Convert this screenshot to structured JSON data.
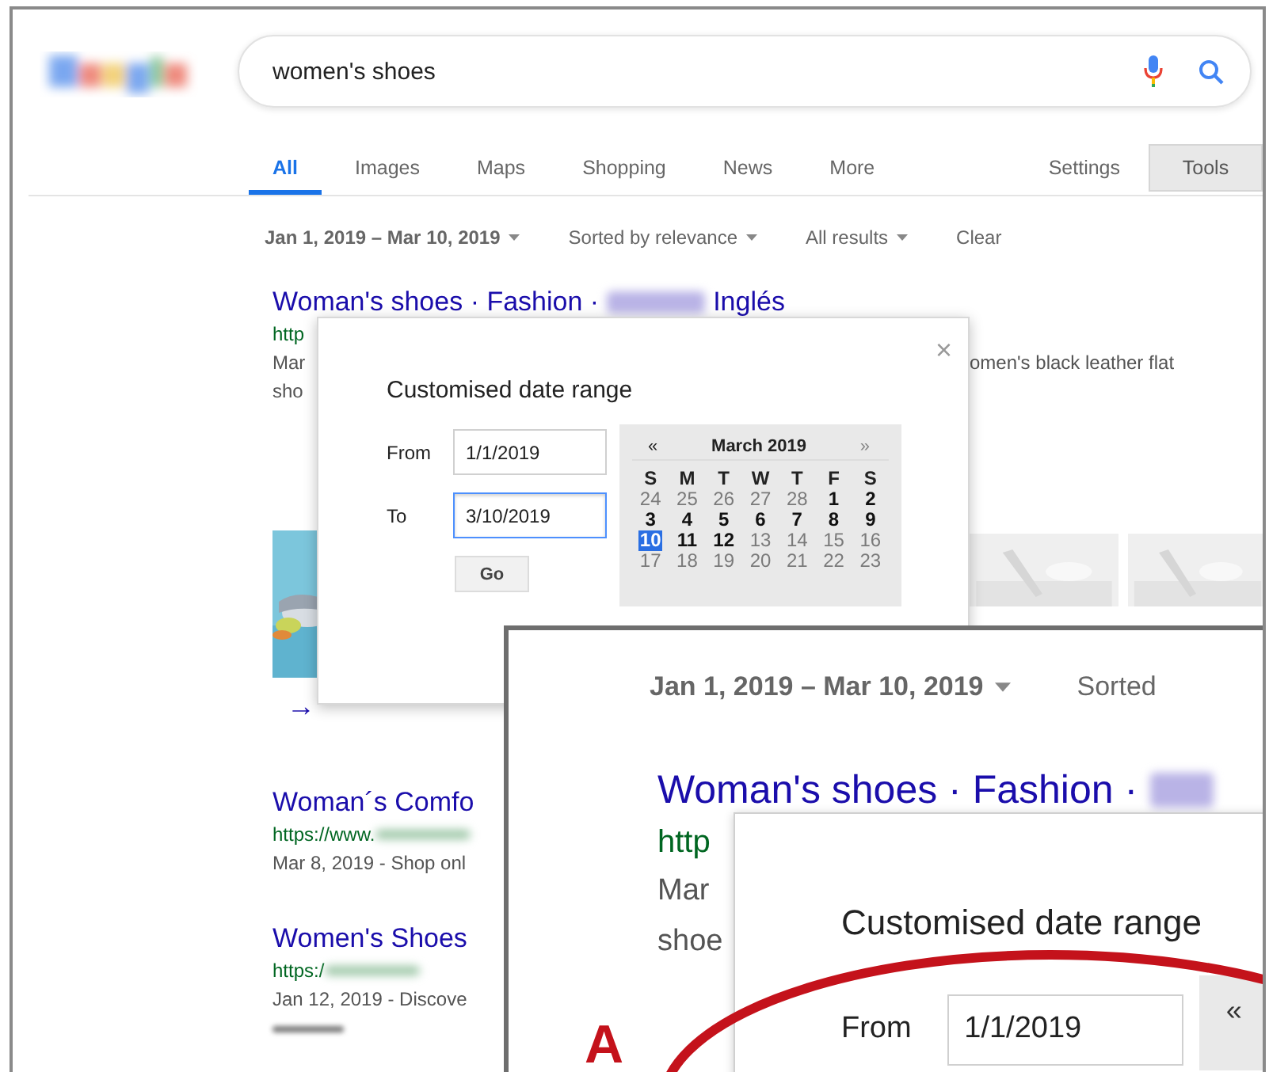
{
  "search": {
    "query": "women's shoes"
  },
  "tabs": [
    {
      "label": "All",
      "selected": true
    },
    {
      "label": "Images",
      "selected": false
    },
    {
      "label": "Maps",
      "selected": false
    },
    {
      "label": "Shopping",
      "selected": false
    },
    {
      "label": "News",
      "selected": false
    },
    {
      "label": "More",
      "selected": false
    }
  ],
  "settings": "Settings",
  "tools": "Tools",
  "filters": [
    {
      "label": "Jan 1, 2019 – Mar 10, 2019",
      "active": true,
      "dropdown": true
    },
    {
      "label": "Sorted by relevance",
      "active": false,
      "dropdown": true
    },
    {
      "label": "All results",
      "active": false,
      "dropdown": true
    },
    {
      "label": "Clear",
      "active": false,
      "dropdown": false
    }
  ],
  "results": [
    {
      "title": "Woman's shoes · Fashion ·",
      "blurred": true,
      "title_end": "Inglés",
      "url": "http",
      "url_blurred": false,
      "snippet": [
        {
          "left": "Mar",
          "right": "omen's black leather flat"
        },
        {
          "left": "sho"
        }
      ]
    },
    {
      "title": "Woman´s Comfo",
      "blurred": false,
      "url": "https://www.",
      "url_blurred": true,
      "snippet": [
        {
          "left": "Mar 8, 2019 - Shop onl"
        }
      ]
    },
    {
      "title": "Women's Shoes",
      "blurred": false,
      "url": "https:/",
      "url_blurred": true,
      "snippet": [
        {
          "left": "Jan 12, 2019 - Discove"
        }
      ]
    }
  ],
  "more_arrow": "→",
  "date_dialog": {
    "close": "×",
    "title": "Customised date range",
    "fields": [
      {
        "label": "From",
        "value": "1/1/2019",
        "focused": false
      },
      {
        "label": "To",
        "value": "3/10/2019",
        "focused": true
      }
    ],
    "go": "Go",
    "calendar": {
      "prev": "«",
      "month": "March 2019",
      "next": "»",
      "weekdays": [
        "S",
        "M",
        "T",
        "W",
        "T",
        "F",
        "S"
      ],
      "weeks": [
        [
          {
            "day": "24",
            "muted": true,
            "selected": false
          },
          {
            "day": "25",
            "muted": true,
            "selected": false
          },
          {
            "day": "26",
            "muted": true,
            "selected": false
          },
          {
            "day": "27",
            "muted": true,
            "selected": false
          },
          {
            "day": "28",
            "muted": true,
            "selected": false
          },
          {
            "day": "1",
            "muted": false,
            "selected": false
          },
          {
            "day": "2",
            "muted": false,
            "selected": false
          }
        ],
        [
          {
            "day": "3",
            "muted": false,
            "selected": false
          },
          {
            "day": "4",
            "muted": false,
            "selected": false
          },
          {
            "day": "5",
            "muted": false,
            "selected": false
          },
          {
            "day": "6",
            "muted": false,
            "selected": false
          },
          {
            "day": "7",
            "muted": false,
            "selected": false
          },
          {
            "day": "8",
            "muted": false,
            "selected": false
          },
          {
            "day": "9",
            "muted": false,
            "selected": false
          }
        ],
        [
          {
            "day": "10",
            "muted": false,
            "selected": true
          },
          {
            "day": "11",
            "muted": false,
            "selected": false
          },
          {
            "day": "12",
            "muted": false,
            "selected": false
          },
          {
            "day": "13",
            "muted": true,
            "selected": false
          },
          {
            "day": "14",
            "muted": true,
            "selected": false
          },
          {
            "day": "15",
            "muted": true,
            "selected": false
          },
          {
            "day": "16",
            "muted": true,
            "selected": false
          }
        ],
        [
          {
            "day": "17",
            "muted": true,
            "selected": false
          },
          {
            "day": "18",
            "muted": true,
            "selected": false
          },
          {
            "day": "19",
            "muted": true,
            "selected": false
          },
          {
            "day": "20",
            "muted": true,
            "selected": false
          },
          {
            "day": "21",
            "muted": true,
            "selected": false
          },
          {
            "day": "22",
            "muted": true,
            "selected": false
          },
          {
            "day": "23",
            "muted": true,
            "selected": false
          }
        ]
      ]
    }
  },
  "inset": {
    "filter": "Jan 1, 2019 – Mar 10, 2019",
    "filter_dropdown": true,
    "next_filter": "Sorted",
    "result": {
      "title": "Woman's shoes · Fashion ·",
      "blurred": true,
      "url": "http",
      "snippet": [
        "Mar",
        "shoe"
      ]
    },
    "dialog": {
      "title": "Customised date range",
      "from_label": "From",
      "from_value": "1/1/2019",
      "calendar_prev": "«"
    },
    "annotation": "A"
  }
}
